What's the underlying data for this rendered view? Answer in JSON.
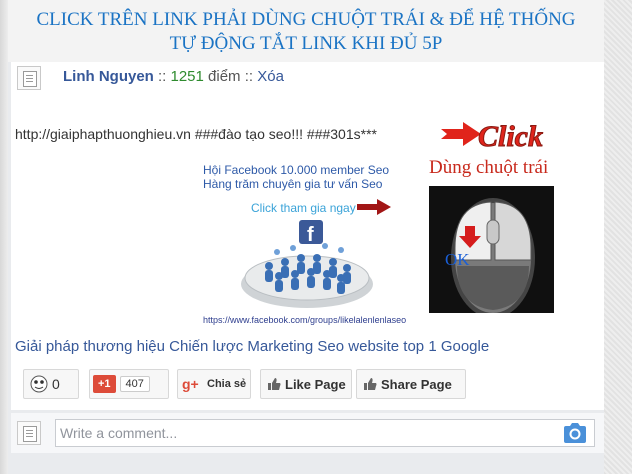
{
  "headline": {
    "line1": "CLICK TRÊN LINK PHẢI DÙNG CHUỘT TRÁI & ĐỂ HỆ THỐNG",
    "line2": "TỰ ĐỘNG TẮT LINK KHI ĐỦ 5P"
  },
  "post": {
    "author": "Linh Nguyen",
    "sep1": " :: ",
    "points_value": "1251",
    "points_unit": " điểm",
    "sep2": " :: ",
    "delete_label": "Xóa",
    "text": "http://giaiphapthuonghieu.vn ###đào tạo seo!!! ###301s***",
    "click_banner_text": "Click",
    "mouse_caption": "Dùng chuột trái",
    "ok_label": "OK",
    "promo_line1": "Hội Facebook 10.000 member Seo",
    "promo_line2": "Hàng trăm chuyên gia tư vấn Seo",
    "promo_cta": "Click tham gia ngay",
    "promo_fb_letter": "f",
    "promo_url": "https://www.facebook.com/groups/likelalenlenlaseo",
    "description": "Giải pháp thương hiệu Chiến lược Marketing Seo website top 1 Google"
  },
  "share_bar": {
    "reaction_count": "0",
    "gplus_label": "+1",
    "gplus_count": "407",
    "gplus_share_label": "Chia sẻ",
    "like_page_label": "Like Page",
    "share_page_label": "Share Page"
  },
  "comment": {
    "placeholder": "Write a comment..."
  },
  "colors": {
    "headline": "#1a73c4",
    "link": "#365899",
    "points": "#2e8b2e",
    "click_red": "#e0241b",
    "mouse_caption": "#c8291c",
    "ok_blue": "#1a5fd6"
  },
  "icons": [
    "avatar-placeholder-icon",
    "arrow-right-icon",
    "mouse-icon",
    "facebook-icon",
    "people-crowd-icon",
    "emoji-icon",
    "google-plus-icon",
    "thumbs-up-icon",
    "camera-icon"
  ]
}
